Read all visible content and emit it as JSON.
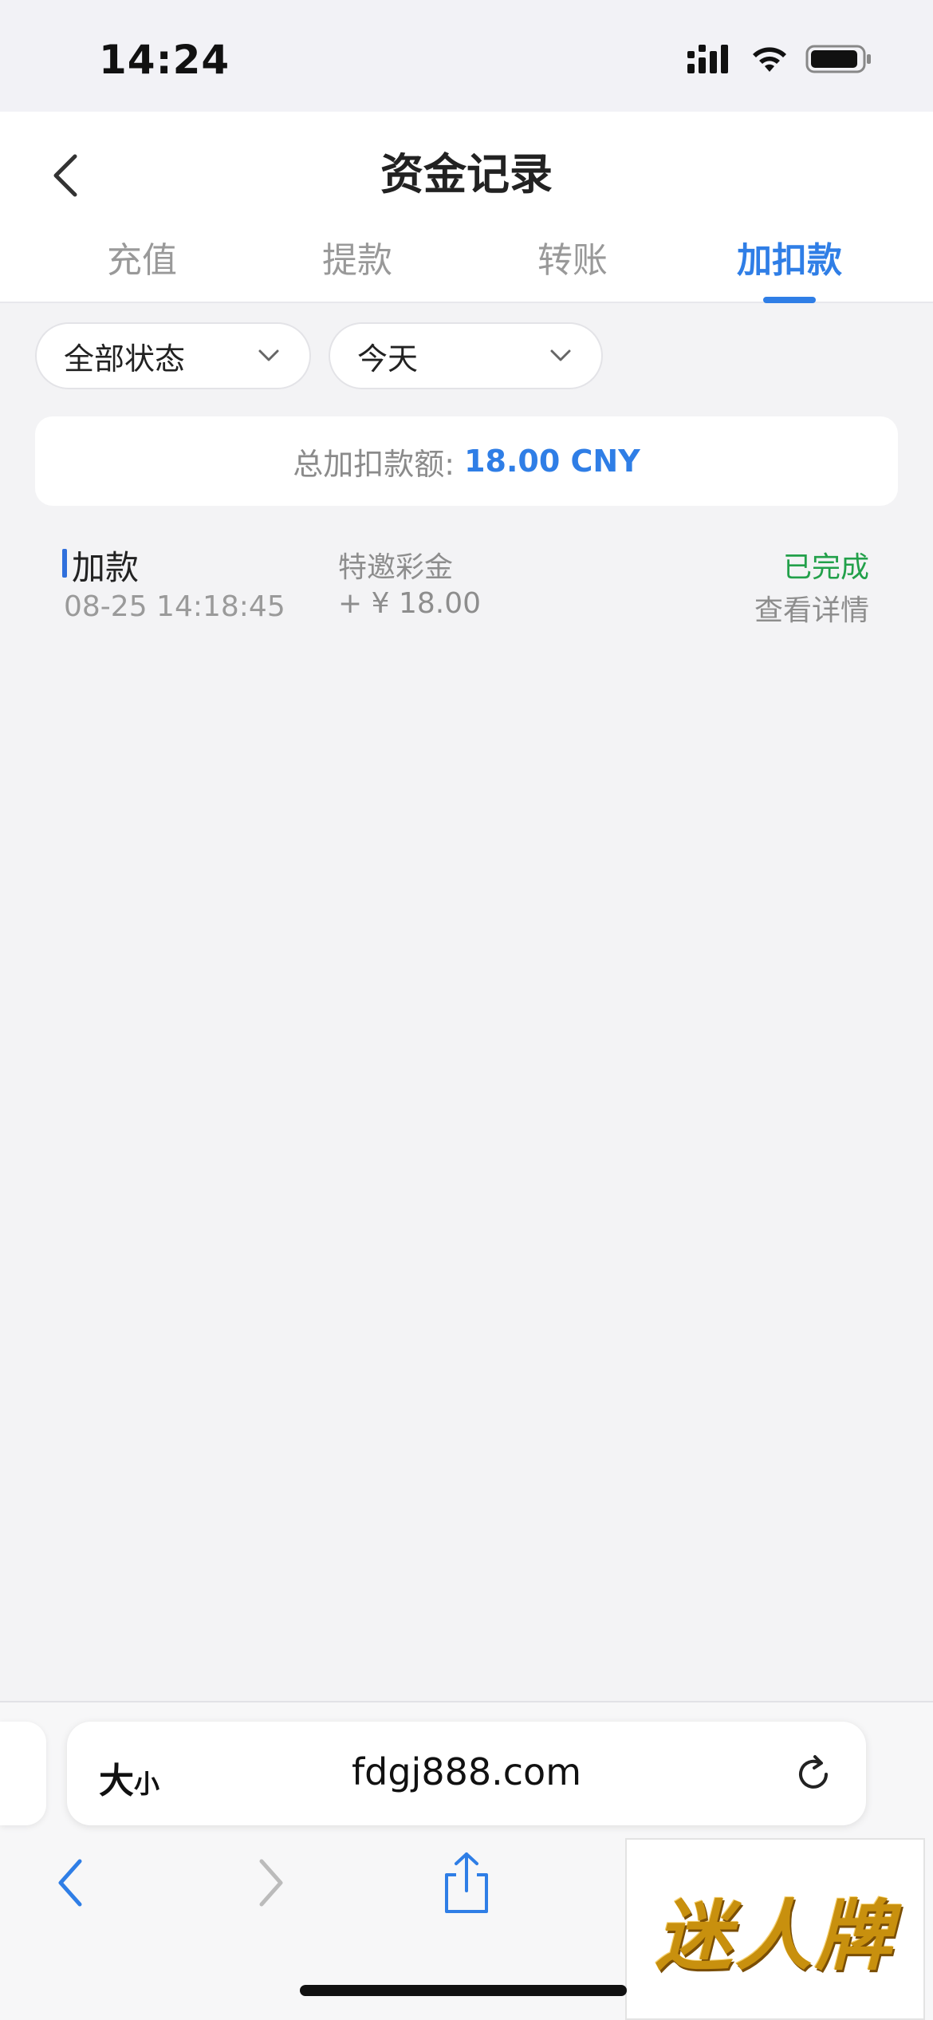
{
  "status_bar": {
    "time": "14:24"
  },
  "header": {
    "title": "资金记录"
  },
  "tabs": [
    {
      "label": "充值",
      "active": false
    },
    {
      "label": "提款",
      "active": false
    },
    {
      "label": "转账",
      "active": false
    },
    {
      "label": "加扣款",
      "active": true
    }
  ],
  "filters": {
    "status": "全部状态",
    "date": "今天"
  },
  "summary": {
    "label": "总加扣款额:",
    "amount": "18.00 CNY"
  },
  "records": [
    {
      "type": "加款",
      "datetime": "08-25 14:18:45",
      "category": "特邀彩金",
      "amount": "+ ¥ 18.00",
      "status": "已完成",
      "detail_link": "查看详情"
    }
  ],
  "browser": {
    "text_size_label": "大",
    "text_size_small": "小",
    "url": "fdgj888.com"
  },
  "watermark": {
    "text": "迷人牌"
  },
  "colors": {
    "accent": "#2f7ee6",
    "success": "#22a04a",
    "muted": "#8d8d8d",
    "background": "#f3f3f5"
  }
}
